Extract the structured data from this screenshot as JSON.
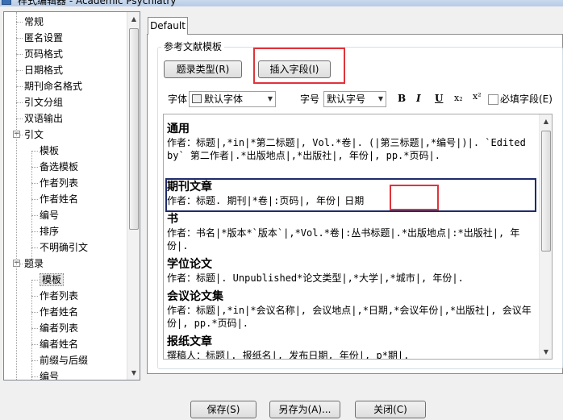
{
  "window": {
    "title": "样式编辑器 - Academic Psychiatry"
  },
  "tree": {
    "items": [
      {
        "label": "常规",
        "level": 1
      },
      {
        "label": "匿名设置",
        "level": 1
      },
      {
        "label": "页码格式",
        "level": 1
      },
      {
        "label": "日期格式",
        "level": 1
      },
      {
        "label": "期刊命名格式",
        "level": 1
      },
      {
        "label": "引文分组",
        "level": 1
      },
      {
        "label": "双语输出",
        "level": 1
      },
      {
        "label": "引文",
        "level": 1,
        "expander": "-"
      },
      {
        "label": "模板",
        "level": 2
      },
      {
        "label": "备选模板",
        "level": 2
      },
      {
        "label": "作者列表",
        "level": 2
      },
      {
        "label": "作者姓名",
        "level": 2
      },
      {
        "label": "编号",
        "level": 2
      },
      {
        "label": "排序",
        "level": 2
      },
      {
        "label": "不明确引文",
        "level": 2
      },
      {
        "label": "题录",
        "level": 1,
        "expander": "-"
      },
      {
        "label": "模板",
        "level": 2,
        "selected": true
      },
      {
        "label": "作者列表",
        "level": 2
      },
      {
        "label": "作者姓名",
        "level": 2
      },
      {
        "label": "编者列表",
        "level": 2
      },
      {
        "label": "编者姓名",
        "level": 2
      },
      {
        "label": "前缀与后缀",
        "level": 2
      },
      {
        "label": "编号",
        "level": 2
      }
    ]
  },
  "tab": {
    "label": "Default"
  },
  "group": {
    "title": "参考文献模板"
  },
  "buttons": {
    "ref_type": "题录类型(R)",
    "insert_field": "插入字段(I)"
  },
  "format_bar": {
    "font_label": "字体",
    "font_value": "默认字体",
    "size_label": "字号",
    "size_value": "默认字号",
    "bold": "B",
    "italic": "I",
    "underline": "U",
    "subscript": "x₂",
    "superscript": "x²",
    "required_label": "必填字段(E)"
  },
  "templates": [
    {
      "title": "通用",
      "body": "作者：标题|,*in|*第二标题|, Vol.*卷|. (|第三标题|,*编号|)|. `Edited by` 第二作者|.*出版地点|,*出版社|, 年份|, pp.*页码|."
    },
    {
      "title": "期刊文章",
      "body_main": "作者：标题. 期刊|*卷|:页码|, 年份|",
      "body_tail": "日期"
    },
    {
      "title": "书",
      "body": "作者：书名|*版本*`版本`|,*Vol.*卷|:丛书标题|.*出版地点|:*出版社|, 年份|."
    },
    {
      "title": "学位论文",
      "body": "作者：标题|. Unpublished*论文类型|,*大学|,*城市|, 年份|."
    },
    {
      "title": "会议论文集",
      "body": "作者：标题|,*in|*会议名称|, 会议地点|,*日期,*会议年份|,*出版社|, 会议年份|, pp.*页码|."
    },
    {
      "title": "报纸文章",
      "body": "撰稿人：标题|. 报纸名|, 发布日期, 年份|, p*期|."
    }
  ],
  "bottom_buttons": {
    "save": "保存(S)",
    "save_as": "另存为(A)...",
    "close": "关闭(C)"
  }
}
